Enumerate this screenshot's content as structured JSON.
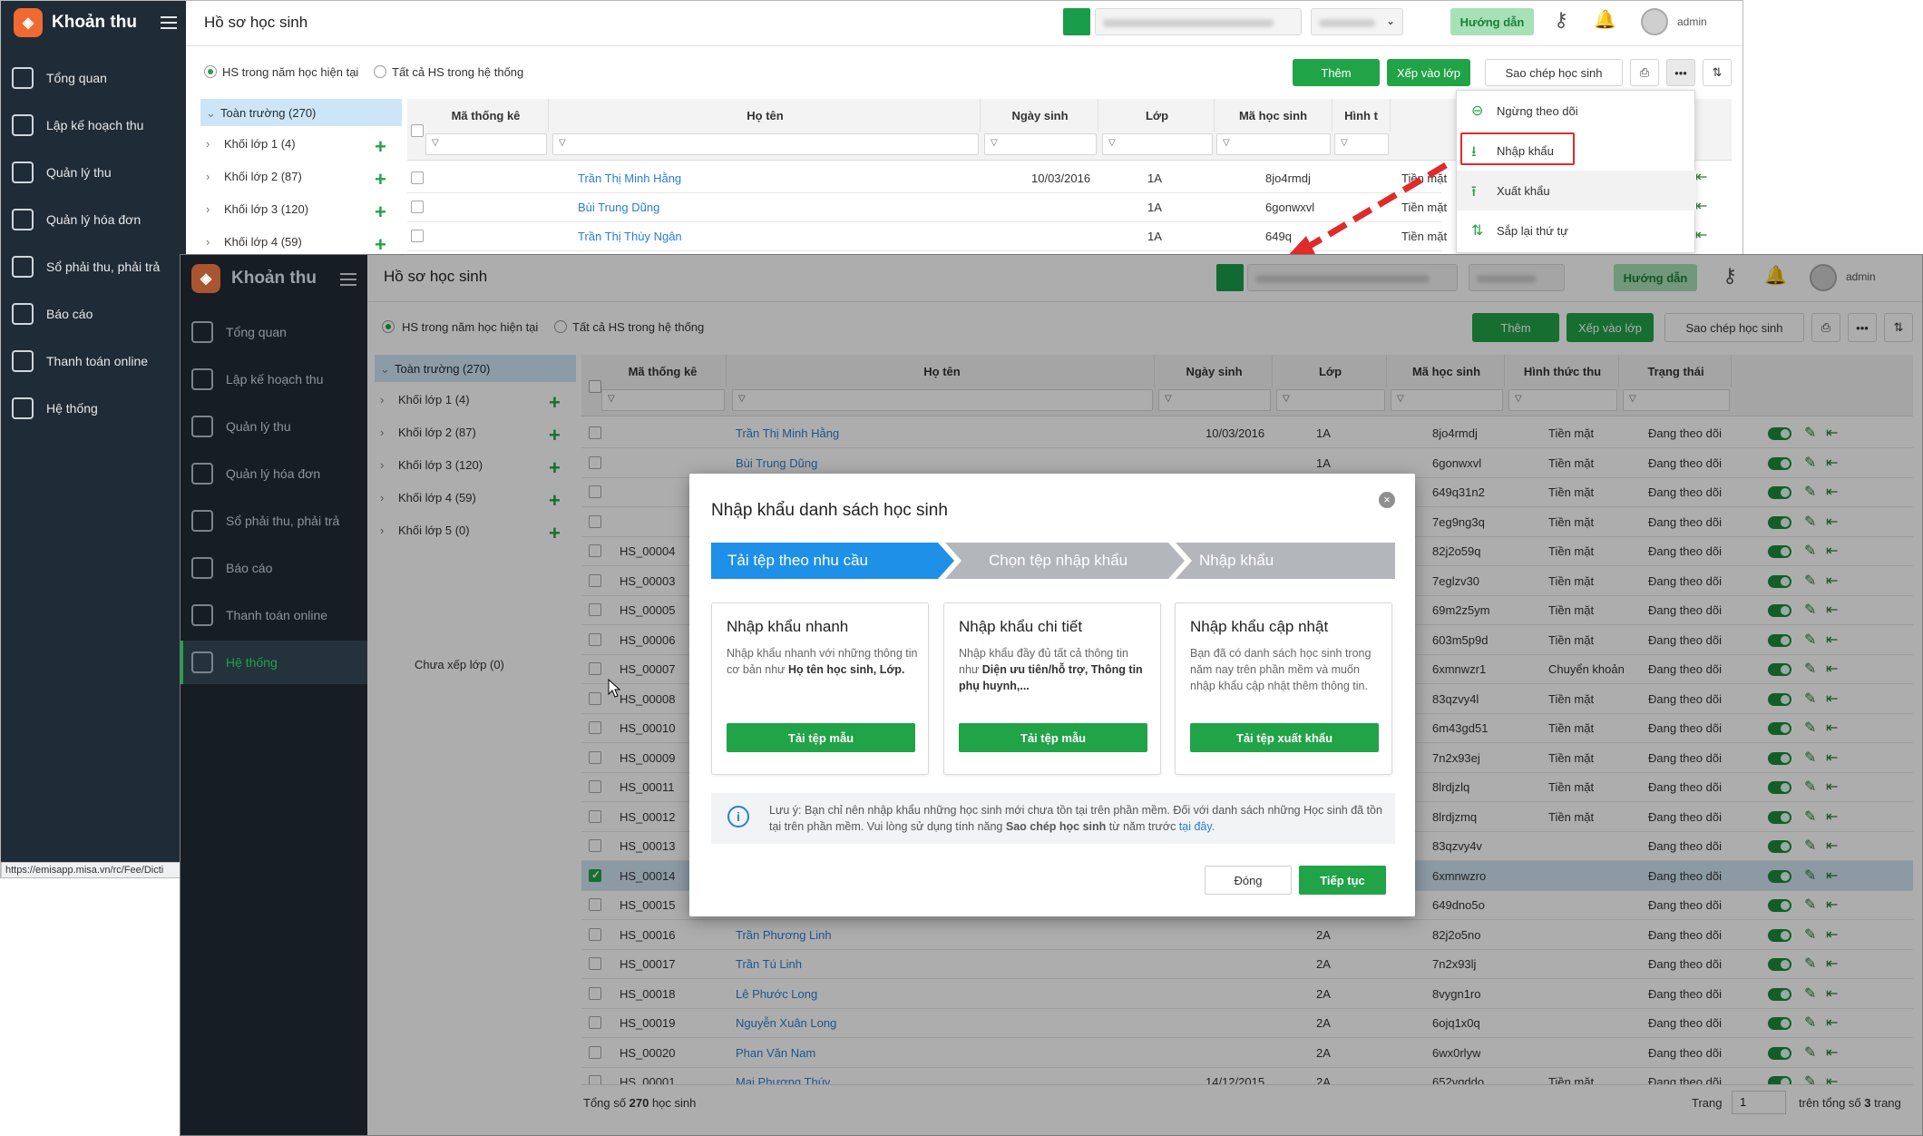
{
  "back": {
    "app_title": "Khoản thu",
    "page_title": "Hồ sơ học sinh",
    "help_label": "Hướng dẫn",
    "user_name": "admin",
    "nav": [
      "Tổng quan",
      "Lập kế hoạch thu",
      "Quản lý thu",
      "Quản lý hóa đơn",
      "Sổ phải thu, phải trả",
      "Báo cáo",
      "Thanh toán online",
      "Hệ thống"
    ],
    "radio_current": "HS trong năm học hiện tại",
    "radio_all": "Tất cả HS trong hệ thống",
    "btn_add": "Thêm",
    "btn_assign": "Xếp vào lớp",
    "btn_copy": "Sao chép học sinh",
    "tree_root": "Toàn trường (270)",
    "tree_items": [
      "Khối lớp 1 (4)",
      "Khối lớp 2 (87)",
      "Khối lớp 3 (120)",
      "Khối lớp 4 (59)"
    ],
    "columns": [
      "Mã thống kê",
      "Họ tên",
      "Ngày sinh",
      "Lớp",
      "Mã học sinh",
      "Hình t"
    ],
    "rows": [
      {
        "name": "Trần Thị Minh Hằng",
        "dob": "10/03/2016",
        "class": "1A",
        "code": "8jo4rmdj",
        "pay": "Tiền mặt"
      },
      {
        "name": "Bùi Trung Dũng",
        "dob": "",
        "class": "1A",
        "code": "6gonwxvl",
        "pay": "Tiền mặt"
      },
      {
        "name": "Trần Thị Thùy Ngân",
        "dob": "",
        "class": "1A",
        "code": "649q",
        "pay": "Tiền mặt"
      }
    ],
    "menu": [
      "Ngừng theo dõi",
      "Nhập khẩu",
      "Xuất khẩu",
      "Sắp lại thứ tự"
    ],
    "status_url": "https://emisapp.misa.vn/rc/Fee/Dicti"
  },
  "front": {
    "app_title": "Khoản thu",
    "page_title": "Hồ sơ học sinh",
    "help_label": "Hướng dẫn",
    "user_name": "admin",
    "nav": [
      "Tổng quan",
      "Lập kế hoạch thu",
      "Quản lý thu",
      "Quản lý hóa đơn",
      "Sổ phải thu, phải trả",
      "Báo cáo",
      "Thanh toán online",
      "Hệ thống"
    ],
    "radio_current": "HS trong năm học hiện tại",
    "radio_all": "Tất cả HS trong hệ thống",
    "btn_add": "Thêm",
    "btn_assign": "Xếp vào lớp",
    "btn_copy": "Sao chép học sinh",
    "tree_root": "Toàn trường (270)",
    "tree_items": [
      "Khối lớp 1 (4)",
      "Khối lớp 2 (87)",
      "Khối lớp 3 (120)",
      "Khối lớp 4 (59)",
      "Khối lớp 5 (0)"
    ],
    "tree_unassigned": "Chưa xếp lớp (0)",
    "columns": [
      "Mã thống kê",
      "Họ tên",
      "Ngày sinh",
      "Lớp",
      "Mã học sinh",
      "Hình thức thu",
      "Trạng thái"
    ],
    "rows": [
      {
        "stat": "",
        "name": "Trần Thị Minh Hằng",
        "dob": "10/03/2016",
        "class": "1A",
        "code": "8jo4rmdj",
        "pay": "Tiền mặt",
        "status": "Đang theo dõi"
      },
      {
        "stat": "",
        "name": "Bùi Trung Dũng",
        "dob": "",
        "class": "1A",
        "code": "6gonwxvl",
        "pay": "Tiền mặt",
        "status": "Đang theo dõi"
      },
      {
        "stat": "",
        "name": "",
        "dob": "",
        "class": "",
        "code": "649q31n2",
        "pay": "Tiền mặt",
        "status": "Đang theo dõi"
      },
      {
        "stat": "",
        "name": "",
        "dob": "",
        "class": "",
        "code": "7eg9ng3q",
        "pay": "Tiền mặt",
        "status": "Đang theo dõi"
      },
      {
        "stat": "HS_00004",
        "name": "",
        "dob": "",
        "class": "",
        "code": "82j2o59q",
        "pay": "Tiền mặt",
        "status": "Đang theo dõi"
      },
      {
        "stat": "HS_00003",
        "name": "",
        "dob": "",
        "class": "",
        "code": "7eglzv30",
        "pay": "Tiền mặt",
        "status": "Đang theo dõi"
      },
      {
        "stat": "HS_00005",
        "name": "",
        "dob": "",
        "class": "",
        "code": "69m2z5ym",
        "pay": "Tiền mặt",
        "status": "Đang theo dõi"
      },
      {
        "stat": "HS_00006",
        "name": "",
        "dob": "",
        "class": "",
        "code": "603m5p9d",
        "pay": "Tiền mặt",
        "status": "Đang theo dõi"
      },
      {
        "stat": "HS_00007",
        "name": "",
        "dob": "",
        "class": "",
        "code": "6xmnwzr1",
        "pay": "Chuyển khoản",
        "status": "Đang theo dõi"
      },
      {
        "stat": "HS_00008",
        "name": "",
        "dob": "",
        "class": "",
        "code": "83qzvy4l",
        "pay": "Tiền mặt",
        "status": "Đang theo dõi"
      },
      {
        "stat": "HS_00010",
        "name": "",
        "dob": "",
        "class": "",
        "code": "6m43gd51",
        "pay": "Tiền mặt",
        "status": "Đang theo dõi"
      },
      {
        "stat": "HS_00009",
        "name": "",
        "dob": "",
        "class": "",
        "code": "7n2x93ej",
        "pay": "Tiền mặt",
        "status": "Đang theo dõi"
      },
      {
        "stat": "HS_00011",
        "name": "",
        "dob": "",
        "class": "",
        "code": "8lrdjzlq",
        "pay": "Tiền mặt",
        "status": "Đang theo dõi"
      },
      {
        "stat": "HS_00012",
        "name": "",
        "dob": "",
        "class": "",
        "code": "8lrdjzmq",
        "pay": "Tiền mặt",
        "status": "Đang theo dõi"
      },
      {
        "stat": "HS_00013",
        "name": "",
        "dob": "",
        "class": "",
        "code": "83qzvy4v",
        "pay": "",
        "status": "Đang theo dõi"
      },
      {
        "stat": "HS_00014",
        "name": "",
        "dob": "",
        "class": "",
        "code": "6xmnwzro",
        "pay": "",
        "status": "Đang theo dõi",
        "checked": true
      },
      {
        "stat": "HS_00015",
        "name": "",
        "dob": "",
        "class": "",
        "code": "649dno5o",
        "pay": "",
        "status": "Đang theo dõi"
      },
      {
        "stat": "HS_00016",
        "name": "Trần Phương Linh",
        "dob": "",
        "class": "2A",
        "code": "82j2o5no",
        "pay": "",
        "status": "Đang theo dõi"
      },
      {
        "stat": "HS_00017",
        "name": "Trần Tú Linh",
        "dob": "",
        "class": "2A",
        "code": "7n2x93lj",
        "pay": "",
        "status": "Đang theo dõi"
      },
      {
        "stat": "HS_00018",
        "name": "Lê Phước Long",
        "dob": "",
        "class": "2A",
        "code": "8vygn1ro",
        "pay": "",
        "status": "Đang theo dõi"
      },
      {
        "stat": "HS_00019",
        "name": "Nguyễn Xuân Long",
        "dob": "",
        "class": "2A",
        "code": "6ojq1x0q",
        "pay": "",
        "status": "Đang theo dõi"
      },
      {
        "stat": "HS_00020",
        "name": "Phan Văn Nam",
        "dob": "",
        "class": "2A",
        "code": "6wx0rlyw",
        "pay": "",
        "status": "Đang theo dõi"
      },
      {
        "stat": "HS_00001",
        "name": "Mai Phương Thúy",
        "dob": "14/12/2015",
        "class": "2A",
        "code": "652vqddo",
        "pay": "Tiền mặt",
        "status": "Đang theo dõi"
      }
    ],
    "footer_total_prefix": "Tổng số",
    "footer_total_count": "270",
    "footer_total_suffix": "học sinh",
    "footer_page_label": "Trang",
    "footer_page_value": "1",
    "footer_of": "trên tổng số",
    "footer_pages": "3",
    "footer_pages_suffix": "trang"
  },
  "modal": {
    "title": "Nhập khẩu danh sách học sinh",
    "steps": [
      "Tải tệp theo nhu cầu",
      "Chọn tệp nhập khẩu",
      "Nhập khẩu"
    ],
    "cards": [
      {
        "title": "Nhập khẩu nhanh",
        "desc_pre": "Nhập khẩu nhanh với những thông tin cơ bản như ",
        "desc_bold": "Họ tên học sinh, Lớp.",
        "btn": "Tải tệp mẫu"
      },
      {
        "title": "Nhập khẩu chi tiết",
        "desc_pre": "Nhập khẩu đầy đủ tất cả thông tin như ",
        "desc_bold": "Diện ưu tiên/hỗ trợ, Thông tin phụ huynh,...",
        "btn": "Tải tệp mẫu"
      },
      {
        "title": "Nhập khẩu cập nhật",
        "desc_pre": "Bạn đã có danh sách học sinh trong năm nay trên phần mềm và muốn nhập khẩu cập nhật thêm thông tin.",
        "desc_bold": "",
        "btn": "Tải tệp xuất khẩu"
      }
    ],
    "note_pre": "Lưu ý: Bạn chỉ nên nhập khẩu những học sinh mới chưa tồn tại trên phần mềm. Đối với danh sách những Học sinh đã tồn tại trên phần mềm. Vui lòng sử dụng tính năng ",
    "note_bold": "Sao chép học sinh",
    "note_mid": " từ năm trước ",
    "note_link": "tại đây.",
    "btn_close": "Đóng",
    "btn_next": "Tiếp tục"
  },
  "colors": {
    "accent": "#21a348",
    "link": "#2b7ed1",
    "highlight": "#e02b2b",
    "step_active": "#1e90e8",
    "step_inactive": "#b3b6ba"
  }
}
